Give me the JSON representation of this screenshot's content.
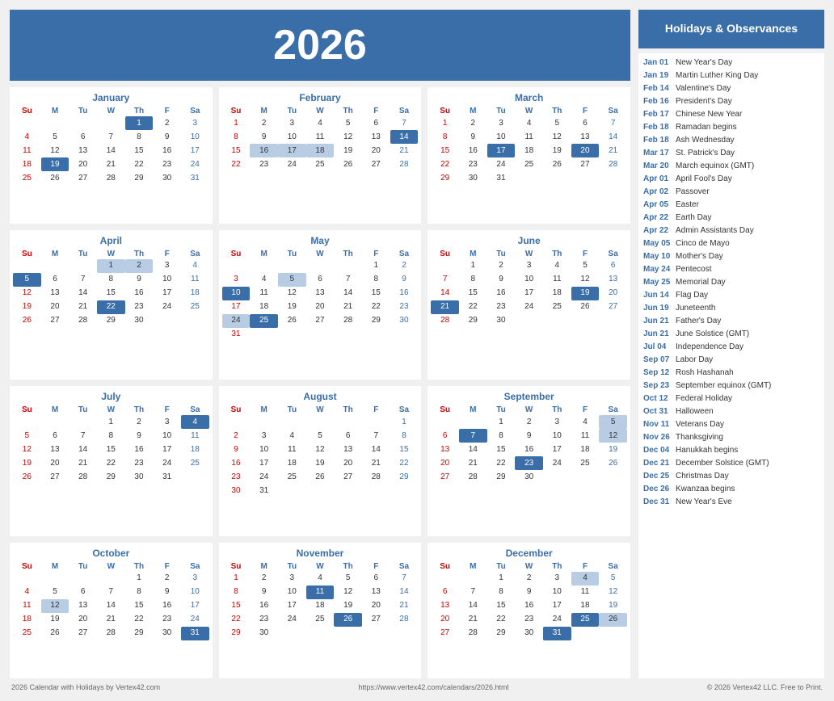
{
  "year": "2026",
  "header": {
    "title": "Holidays & Observances"
  },
  "footer": {
    "left": "2026 Calendar with Holidays by Vertex42.com",
    "center": "https://www.vertex42.com/calendars/2026.html",
    "right": "© 2026 Vertex42 LLC. Free to Print."
  },
  "holidays": [
    {
      "date": "Jan 01",
      "name": "New Year's Day"
    },
    {
      "date": "Jan 19",
      "name": "Martin Luther King Day"
    },
    {
      "date": "Feb 14",
      "name": "Valentine's Day"
    },
    {
      "date": "Feb 16",
      "name": "President's Day"
    },
    {
      "date": "Feb 17",
      "name": "Chinese New Year"
    },
    {
      "date": "Feb 18",
      "name": "Ramadan begins"
    },
    {
      "date": "Feb 18",
      "name": "Ash Wednesday"
    },
    {
      "date": "Mar 17",
      "name": "St. Patrick's Day"
    },
    {
      "date": "Mar 20",
      "name": "March equinox (GMT)"
    },
    {
      "date": "Apr 01",
      "name": "April Fool's Day"
    },
    {
      "date": "Apr 02",
      "name": "Passover"
    },
    {
      "date": "Apr 05",
      "name": "Easter"
    },
    {
      "date": "Apr 22",
      "name": "Earth Day"
    },
    {
      "date": "Apr 22",
      "name": "Admin Assistants Day"
    },
    {
      "date": "May 05",
      "name": "Cinco de Mayo"
    },
    {
      "date": "May 10",
      "name": "Mother's Day"
    },
    {
      "date": "May 24",
      "name": "Pentecost"
    },
    {
      "date": "May 25",
      "name": "Memorial Day"
    },
    {
      "date": "Jun 14",
      "name": "Flag Day"
    },
    {
      "date": "Jun 19",
      "name": "Juneteenth"
    },
    {
      "date": "Jun 21",
      "name": "Father's Day"
    },
    {
      "date": "Jun 21",
      "name": "June Solstice (GMT)"
    },
    {
      "date": "Jul 04",
      "name": "Independence Day"
    },
    {
      "date": "Sep 07",
      "name": "Labor Day"
    },
    {
      "date": "Sep 12",
      "name": "Rosh Hashanah"
    },
    {
      "date": "Sep 23",
      "name": "September equinox (GMT)"
    },
    {
      "date": "Oct 12",
      "name": "Federal Holiday"
    },
    {
      "date": "Oct 31",
      "name": "Halloween"
    },
    {
      "date": "Nov 11",
      "name": "Veterans Day"
    },
    {
      "date": "Nov 26",
      "name": "Thanksgiving"
    },
    {
      "date": "Dec 04",
      "name": "Hanukkah begins"
    },
    {
      "date": "Dec 21",
      "name": "December Solstice (GMT)"
    },
    {
      "date": "Dec 25",
      "name": "Christmas Day"
    },
    {
      "date": "Dec 26",
      "name": "Kwanzaa begins"
    },
    {
      "date": "Dec 31",
      "name": "New Year's Eve"
    }
  ],
  "months": [
    {
      "name": "January",
      "weeks": [
        [
          "",
          "",
          "",
          "",
          "1",
          "2",
          "3"
        ],
        [
          "4",
          "5",
          "6",
          "7",
          "8",
          "9",
          "10"
        ],
        [
          "11",
          "12",
          "13",
          "14",
          "15",
          "16",
          "17"
        ],
        [
          "18",
          "19",
          "20",
          "21",
          "22",
          "23",
          "24"
        ],
        [
          "25",
          "26",
          "27",
          "28",
          "29",
          "30",
          "31"
        ]
      ],
      "highlights": {
        "blue": [
          "1",
          "19"
        ],
        "light": []
      }
    },
    {
      "name": "February",
      "weeks": [
        [
          "1",
          "2",
          "3",
          "4",
          "5",
          "6",
          "7"
        ],
        [
          "8",
          "9",
          "10",
          "11",
          "12",
          "13",
          "14"
        ],
        [
          "15",
          "16",
          "17",
          "18",
          "19",
          "20",
          "21"
        ],
        [
          "22",
          "23",
          "24",
          "25",
          "26",
          "27",
          "28"
        ]
      ],
      "highlights": {
        "blue": [
          "14"
        ],
        "light": [
          "16",
          "17",
          "18"
        ]
      }
    },
    {
      "name": "March",
      "weeks": [
        [
          "1",
          "2",
          "3",
          "4",
          "5",
          "6",
          "7"
        ],
        [
          "8",
          "9",
          "10",
          "11",
          "12",
          "13",
          "14"
        ],
        [
          "15",
          "16",
          "17",
          "18",
          "19",
          "20",
          "21"
        ],
        [
          "22",
          "23",
          "24",
          "25",
          "26",
          "27",
          "28"
        ],
        [
          "29",
          "30",
          "31",
          "",
          "",
          "",
          ""
        ]
      ],
      "highlights": {
        "blue": [
          "17",
          "20"
        ],
        "light": []
      }
    },
    {
      "name": "April",
      "weeks": [
        [
          "",
          "",
          "",
          "1",
          "2",
          "3",
          "4"
        ],
        [
          "5",
          "6",
          "7",
          "8",
          "9",
          "10",
          "11"
        ],
        [
          "12",
          "13",
          "14",
          "15",
          "16",
          "17",
          "18"
        ],
        [
          "19",
          "20",
          "21",
          "22",
          "23",
          "24",
          "25"
        ],
        [
          "26",
          "27",
          "28",
          "29",
          "30",
          "",
          ""
        ]
      ],
      "highlights": {
        "blue": [
          "5",
          "22"
        ],
        "light": [
          "1",
          "2"
        ]
      }
    },
    {
      "name": "May",
      "weeks": [
        [
          "",
          "",
          "",
          "",
          "",
          "1",
          "2"
        ],
        [
          "3",
          "4",
          "5",
          "6",
          "7",
          "8",
          "9"
        ],
        [
          "10",
          "11",
          "12",
          "13",
          "14",
          "15",
          "16"
        ],
        [
          "17",
          "18",
          "19",
          "20",
          "21",
          "22",
          "23"
        ],
        [
          "24",
          "25",
          "26",
          "27",
          "28",
          "29",
          "30"
        ],
        [
          "31",
          "",
          "",
          "",
          "",
          "",
          ""
        ]
      ],
      "highlights": {
        "blue": [
          "10",
          "25"
        ],
        "light": [
          "5",
          "24"
        ]
      }
    },
    {
      "name": "June",
      "weeks": [
        [
          "",
          "1",
          "2",
          "3",
          "4",
          "5",
          "6"
        ],
        [
          "7",
          "8",
          "9",
          "10",
          "11",
          "12",
          "13"
        ],
        [
          "14",
          "15",
          "16",
          "17",
          "18",
          "19",
          "20"
        ],
        [
          "21",
          "22",
          "23",
          "24",
          "25",
          "26",
          "27"
        ],
        [
          "28",
          "29",
          "30",
          "",
          "",
          "",
          ""
        ]
      ],
      "highlights": {
        "blue": [
          "19",
          "21"
        ],
        "light": []
      }
    },
    {
      "name": "July",
      "weeks": [
        [
          "",
          "",
          "",
          "1",
          "2",
          "3",
          "4"
        ],
        [
          "5",
          "6",
          "7",
          "8",
          "9",
          "10",
          "11"
        ],
        [
          "12",
          "13",
          "14",
          "15",
          "16",
          "17",
          "18"
        ],
        [
          "19",
          "20",
          "21",
          "22",
          "23",
          "24",
          "25"
        ],
        [
          "26",
          "27",
          "28",
          "29",
          "30",
          "31",
          ""
        ]
      ],
      "highlights": {
        "blue": [
          "4"
        ],
        "light": []
      }
    },
    {
      "name": "August",
      "weeks": [
        [
          "",
          "",
          "",
          "",
          "",
          "",
          "1"
        ],
        [
          "2",
          "3",
          "4",
          "5",
          "6",
          "7",
          "8"
        ],
        [
          "9",
          "10",
          "11",
          "12",
          "13",
          "14",
          "15"
        ],
        [
          "16",
          "17",
          "18",
          "19",
          "20",
          "21",
          "22"
        ],
        [
          "23",
          "24",
          "25",
          "26",
          "27",
          "28",
          "29"
        ],
        [
          "30",
          "31",
          "",
          "",
          "",
          "",
          ""
        ]
      ],
      "highlights": {
        "blue": [],
        "light": []
      }
    },
    {
      "name": "September",
      "weeks": [
        [
          "",
          "",
          "1",
          "2",
          "3",
          "4",
          "5"
        ],
        [
          "6",
          "7",
          "8",
          "9",
          "10",
          "11",
          "12"
        ],
        [
          "13",
          "14",
          "15",
          "16",
          "17",
          "18",
          "19"
        ],
        [
          "20",
          "21",
          "22",
          "23",
          "24",
          "25",
          "26"
        ],
        [
          "27",
          "28",
          "29",
          "30",
          "",
          "",
          ""
        ]
      ],
      "highlights": {
        "blue": [
          "7",
          "23"
        ],
        "light": [
          "5",
          "12"
        ]
      }
    },
    {
      "name": "October",
      "weeks": [
        [
          "",
          "",
          "",
          "",
          "1",
          "2",
          "3"
        ],
        [
          "4",
          "5",
          "6",
          "7",
          "8",
          "9",
          "10"
        ],
        [
          "11",
          "12",
          "13",
          "14",
          "15",
          "16",
          "17"
        ],
        [
          "18",
          "19",
          "20",
          "21",
          "22",
          "23",
          "24"
        ],
        [
          "25",
          "26",
          "27",
          "28",
          "29",
          "30",
          "31"
        ]
      ],
      "highlights": {
        "blue": [
          "31"
        ],
        "light": [
          "12"
        ]
      }
    },
    {
      "name": "November",
      "weeks": [
        [
          "1",
          "2",
          "3",
          "4",
          "5",
          "6",
          "7"
        ],
        [
          "8",
          "9",
          "10",
          "11",
          "12",
          "13",
          "14"
        ],
        [
          "15",
          "16",
          "17",
          "18",
          "19",
          "20",
          "21"
        ],
        [
          "22",
          "23",
          "24",
          "25",
          "26",
          "27",
          "28"
        ],
        [
          "29",
          "30",
          "",
          "",
          "",
          "",
          ""
        ]
      ],
      "highlights": {
        "blue": [
          "11",
          "26"
        ],
        "light": []
      }
    },
    {
      "name": "December",
      "weeks": [
        [
          "",
          "",
          "1",
          "2",
          "3",
          "4",
          "5"
        ],
        [
          "6",
          "7",
          "8",
          "9",
          "10",
          "11",
          "12"
        ],
        [
          "13",
          "14",
          "15",
          "16",
          "17",
          "18",
          "19"
        ],
        [
          "20",
          "21",
          "22",
          "23",
          "24",
          "25",
          "26"
        ],
        [
          "27",
          "28",
          "29",
          "30",
          "31",
          "",
          ""
        ]
      ],
      "highlights": {
        "blue": [
          "25",
          "31"
        ],
        "light": [
          "4",
          "26"
        ]
      }
    }
  ],
  "dayHeaders": [
    "Su",
    "M",
    "Tu",
    "W",
    "Th",
    "F",
    "Sa"
  ]
}
